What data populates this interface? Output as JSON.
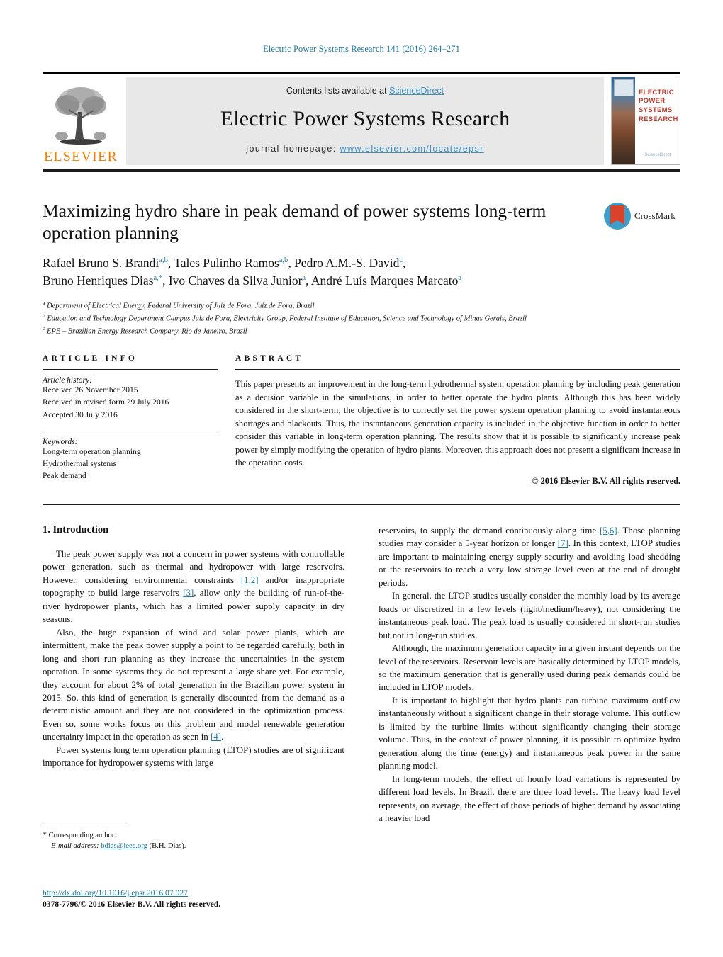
{
  "running_head": "Electric Power Systems Research 141 (2016) 264–271",
  "masthead": {
    "contents_prefix": "Contents lists available at ",
    "sciencedirect": "ScienceDirect",
    "journal_title": "Electric Power Systems Research",
    "homepage_prefix": "journal homepage: ",
    "homepage_url": "www.elsevier.com/locate/epsr",
    "publisher_wordmark": "ELSEVIER",
    "cover_title_line1": "ELECTRIC POWER",
    "cover_title_line2": "SYSTEMS RESEARCH",
    "cover_footer": "ScienceDirect",
    "accent_link_color": "#3a8fc4",
    "elsevier_orange": "#f08000"
  },
  "article": {
    "title": "Maximizing hydro share in peak demand of power systems long-term operation planning",
    "crossmark_label": "CrossMark",
    "authors_line1_a": "Rafael Bruno S. Brandi",
    "authors_line1_a_sup": "a,b",
    "authors_line1_b": ", Tales Pulinho Ramos",
    "authors_line1_b_sup": "a,b",
    "authors_line1_c": ", Pedro A.M.-S. David",
    "authors_line1_c_sup": "c",
    "authors_line1_end": ",",
    "authors_line2_a": "Bruno Henriques Dias",
    "authors_line2_a_sup": "a,",
    "authors_line2_a_star": "*",
    "authors_line2_b": ", Ivo Chaves da Silva Junior",
    "authors_line2_b_sup": "a",
    "authors_line2_c": ", André Luís Marques Marcato",
    "authors_line2_c_sup": "a",
    "affiliations": [
      {
        "marker": "a",
        "text": "Department of Electrical Energy, Federal University of Juiz de Fora, Juiz de Fora, Brazil"
      },
      {
        "marker": "b",
        "text": "Education and Technology Department Campus Juiz de Fora, Electricity Group, Federal Institute of Education, Science and Technology of Minas Gerais, Brazil"
      },
      {
        "marker": "c",
        "text": "EPE – Brazilian Energy Research Company, Rio de Janeiro, Brazil"
      }
    ]
  },
  "article_info": {
    "heading": "ARTICLE INFO",
    "history_label": "Article history:",
    "history": [
      "Received 26 November 2015",
      "Received in revised form 29 July 2016",
      "Accepted 30 July 2016"
    ],
    "keywords_label": "Keywords:",
    "keywords": [
      "Long-term operation planning",
      "Hydrothermal systems",
      "Peak demand"
    ]
  },
  "abstract": {
    "heading": "ABSTRACT",
    "text": "This paper presents an improvement in the long-term hydrothermal system operation planning by including peak generation as a decision variable in the simulations, in order to better operate the hydro plants. Although this has been widely considered in the short-term, the objective is to correctly set the power system operation planning to avoid instantaneous shortages and blackouts. Thus, the instantaneous generation capacity is included in the objective function in order to better consider this variable in long-term operation planning. The results show that it is possible to significantly increase peak power by simply modifying the operation of hydro plants. Moreover, this approach does not present a significant increase in the operation costs.",
    "copyright": "© 2016 Elsevier B.V. All rights reserved."
  },
  "body": {
    "section_heading": "1. Introduction",
    "left_paragraphs": [
      {
        "pre": "The peak power supply was not a concern in power systems with controllable power generation, such as thermal and hydropower with large reservoirs. However, considering environmental constraints ",
        "ref1": "[1,2]",
        "mid": " and/or inappropriate topography to build large reservoirs ",
        "ref2": "[3]",
        "post": ", allow only the building of run-of-the-river hydropower plants, which has a limited power supply capacity in dry seasons."
      },
      {
        "pre": "Also, the huge expansion of wind and solar power plants, which are intermittent, make the peak power supply a point to be regarded carefully, both in long and short run planning as they increase the uncertainties in the system operation. In some systems they do not represent a large share yet. For example, they account for about 2% of total generation in the Brazilian power system in 2015. So, this kind of generation is generally discounted from the demand as a deterministic amount and they are not considered in the optimization process. Even so, some works focus on this problem and model renewable generation uncertainty impact in the operation as seen in ",
        "ref1": "[4]",
        "mid": "",
        "ref2": "",
        "post": "."
      },
      {
        "pre": "Power systems long term operation planning (LTOP) studies are of significant importance for hydropower systems with large",
        "ref1": "",
        "mid": "",
        "ref2": "",
        "post": ""
      }
    ],
    "right_paragraphs": [
      {
        "pre": "reservoirs, to supply the demand continuously along time ",
        "ref1": "[5,6]",
        "mid": ". Those planning studies may consider a 5-year horizon or longer ",
        "ref2": "[7]",
        "post": ". In this context, LTOP studies are important to maintaining energy supply security and avoiding load shedding or the reservoirs to reach a very low storage level even at the end of drought periods.",
        "indent": false
      },
      {
        "pre": "In general, the LTOP studies usually consider the monthly load by its average loads or discretized in a few levels (light/medium/heavy), not considering the instantaneous peak load. The peak load is usually considered in short-run studies but not in long-run studies.",
        "ref1": "",
        "mid": "",
        "ref2": "",
        "post": "",
        "indent": true
      },
      {
        "pre": "Although, the maximum generation capacity in a given instant depends on the level of the reservoirs. Reservoir levels are basically determined by LTOP models, so the maximum generation that is generally used during peak demands could be included in LTOP models.",
        "ref1": "",
        "mid": "",
        "ref2": "",
        "post": "",
        "indent": true
      },
      {
        "pre": "It is important to highlight that hydro plants can turbine maximum outflow instantaneously without a significant change in their storage volume. This outflow is limited by the turbine limits without significantly changing their storage volume. Thus, in the context of power planning, it is possible to optimize hydro generation along the time (energy) and instantaneous peak power in the same planning model.",
        "ref1": "",
        "mid": "",
        "ref2": "",
        "post": "",
        "indent": true
      },
      {
        "pre": "In long-term models, the effect of hourly load variations is represented by different load levels. In Brazil, there are three load levels. The heavy load level represents, on average, the effect of those periods of higher demand by associating a heavier load",
        "ref1": "",
        "mid": "",
        "ref2": "",
        "post": "",
        "indent": true
      }
    ]
  },
  "footnotes": {
    "corresponding_star": "*",
    "corresponding_text": "Corresponding author.",
    "email_label": "E-mail address:",
    "email": "bdias@ieee.org",
    "email_owner": "(B.H. Dias)."
  },
  "imprint": {
    "doi": "http://dx.doi.org/10.1016/j.epsr.2016.07.027",
    "issn_line": "0378-7796/© 2016 Elsevier B.V. All rights reserved."
  }
}
